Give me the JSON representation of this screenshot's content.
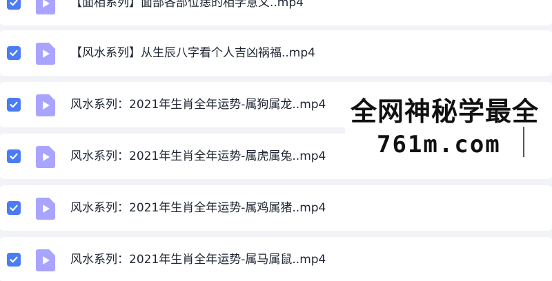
{
  "files": [
    {
      "name": "【面相系列】面部各部位痣的相学意义..mp4",
      "selected": true
    },
    {
      "name": "【风水系列】从生辰八字看个人吉凶祸福..mp4",
      "selected": true
    },
    {
      "name": "风水系列：2021年生肖全年运势-属狗属龙..mp4",
      "selected": true
    },
    {
      "name": "风水系列：2021年生肖全年运势-属虎属兔..mp4",
      "selected": true
    },
    {
      "name": "风水系列：2021年生肖全年运势-属鸡属猪..mp4",
      "selected": true
    },
    {
      "name": "风水系列：2021年生肖全年运势-属马属鼠..mp4",
      "selected": true
    }
  ],
  "icons": {
    "checkbox": "checkbox-checked-icon",
    "file": "video-play-icon"
  },
  "colors": {
    "checkbox": "#4b7bf5",
    "file_icon": "#a9a4ff",
    "background": "#f2f3f7"
  },
  "watermark": {
    "line1": "全网神秘学最全",
    "line2": "761m.com"
  }
}
